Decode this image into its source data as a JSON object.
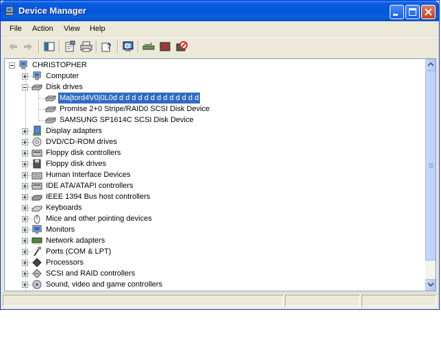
{
  "window": {
    "title": "Device Manager"
  },
  "menu": [
    "File",
    "Action",
    "View",
    "Help"
  ],
  "toolbar": [
    "back-icon",
    "forward-icon",
    "show-hide-console-tree-icon",
    "properties-icon",
    "print-icon",
    "help-icon",
    "scan-hardware-icon",
    "update-driver-icon",
    "uninstall-icon",
    "disable-icon"
  ],
  "tree": {
    "root": "CHRISTOPHER",
    "items": [
      {
        "label": "Computer",
        "icon": "computer-icon"
      },
      {
        "label": "Disk drives",
        "icon": "disk-drive-icon",
        "expanded": true,
        "children": [
          {
            "label": "Ma|tord4V0|0L0d d d d d d d d d d d d d d",
            "selected": true
          },
          {
            "label": "Promise 2+0 Stripe/RAID0 SCSI Disk Device"
          },
          {
            "label": "SAMSUNG SP1614C SCSI Disk Device"
          }
        ]
      },
      {
        "label": "Display adapters",
        "icon": "display-adapter-icon"
      },
      {
        "label": "DVD/CD-ROM drives",
        "icon": "dvd-drive-icon"
      },
      {
        "label": "Floppy disk controllers",
        "icon": "floppy-controller-icon"
      },
      {
        "label": "Floppy disk drives",
        "icon": "floppy-drive-icon"
      },
      {
        "label": "Human Interface Devices",
        "icon": "hid-icon"
      },
      {
        "label": "IDE ATA/ATAPI controllers",
        "icon": "ide-controller-icon"
      },
      {
        "label": "IEEE 1394 Bus host controllers",
        "icon": "ieee1394-icon"
      },
      {
        "label": "Keyboards",
        "icon": "keyboard-icon"
      },
      {
        "label": "Mice and other pointing devices",
        "icon": "mouse-icon"
      },
      {
        "label": "Monitors",
        "icon": "monitor-icon"
      },
      {
        "label": "Network adapters",
        "icon": "network-adapter-icon"
      },
      {
        "label": "Ports (COM & LPT)",
        "icon": "port-icon"
      },
      {
        "label": "Processors",
        "icon": "processor-icon"
      },
      {
        "label": "SCSI and RAID controllers",
        "icon": "scsi-controller-icon"
      },
      {
        "label": "Sound, video and game controllers",
        "icon": "sound-icon"
      }
    ]
  },
  "colors": {
    "titlebar": "#0655d8",
    "selection": "#316ac5",
    "chrome": "#ece9d8"
  }
}
